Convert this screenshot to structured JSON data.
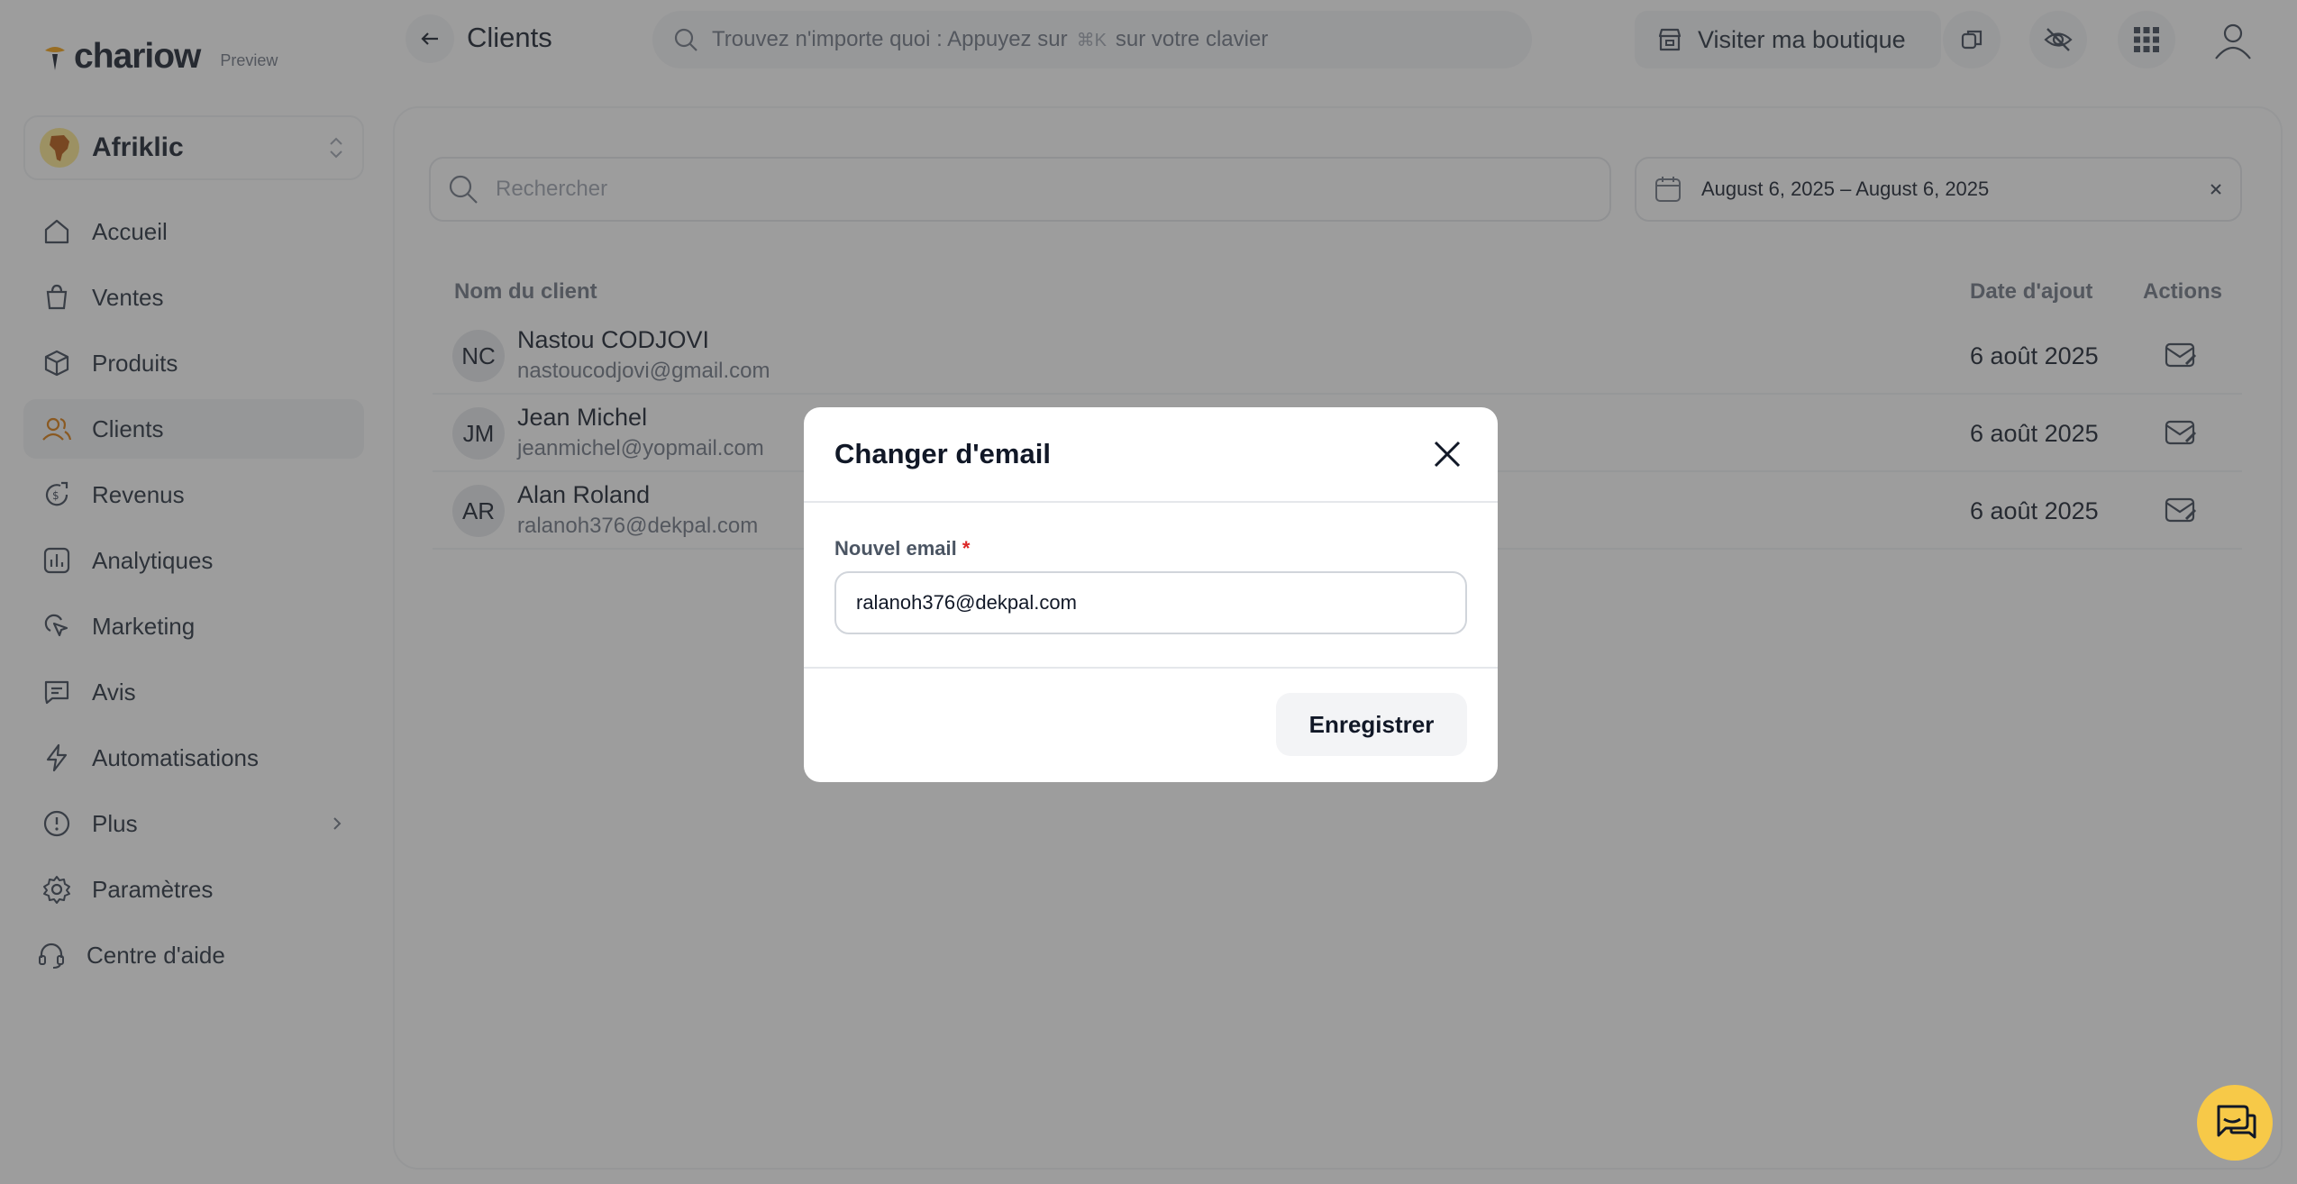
{
  "app": {
    "brand": "chariow",
    "preview_tag": "Preview",
    "store_name": "Afriklic",
    "accent": "#f7c948"
  },
  "sidebar": {
    "items": [
      {
        "label": "Accueil",
        "icon": "home-icon"
      },
      {
        "label": "Ventes",
        "icon": "shopping-bag-icon"
      },
      {
        "label": "Produits",
        "icon": "box-icon"
      },
      {
        "label": "Clients",
        "icon": "users-icon",
        "active": true
      },
      {
        "label": "Revenus",
        "icon": "revenue-icon"
      },
      {
        "label": "Analytiques",
        "icon": "bar-chart-icon"
      },
      {
        "label": "Marketing",
        "icon": "cursor-click-icon"
      },
      {
        "label": "Avis",
        "icon": "message-icon"
      },
      {
        "label": "Automatisations",
        "icon": "lightning-icon"
      },
      {
        "label": "Plus",
        "icon": "more-icon"
      },
      {
        "label": "Paramètres",
        "icon": "gear-icon"
      }
    ],
    "help": "Centre d'aide"
  },
  "header": {
    "title": "Clients",
    "search_before": "Trouvez n'importe quoi : Appuyez sur",
    "search_kbd": "⌘K",
    "search_after": "sur votre clavier",
    "visit_store": "Visiter ma boutique"
  },
  "filters": {
    "search_placeholder": "Rechercher",
    "date_range": "August 6, 2025 – August 6, 2025"
  },
  "table": {
    "headers": {
      "name": "Nom du client",
      "date": "Date d'ajout",
      "actions": "Actions"
    },
    "rows": [
      {
        "initials": "NC",
        "name": "Nastou CODJOVI",
        "email": "nastoucodjovi@gmail.com",
        "date": "6 août 2025"
      },
      {
        "initials": "JM",
        "name": "Jean Michel",
        "email": "jeanmichel@yopmail.com",
        "date": "6 août 2025"
      },
      {
        "initials": "AR",
        "name": "Alan Roland",
        "email": "ralanoh376@dekpal.com",
        "date": "6 août 2025"
      }
    ]
  },
  "modal": {
    "title": "Changer d'email",
    "field_label": "Nouvel email",
    "required_mark": "*",
    "email_value": "ralanoh376@dekpal.com",
    "save_label": "Enregistrer"
  }
}
